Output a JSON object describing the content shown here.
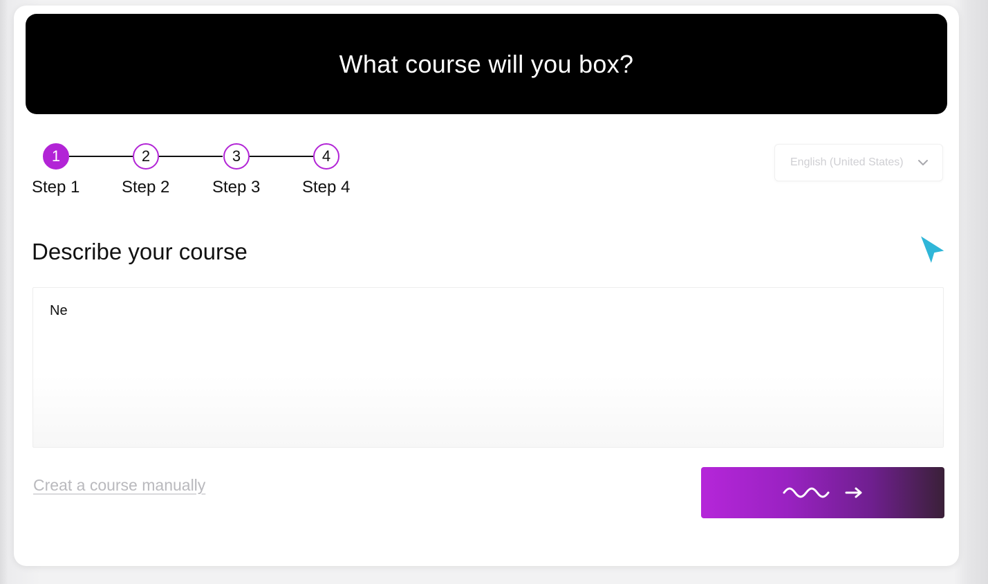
{
  "header": {
    "title": "What course will you box?"
  },
  "stepper": {
    "steps": [
      {
        "number": "1",
        "label": "Step 1",
        "active": true
      },
      {
        "number": "2",
        "label": "Step 2",
        "active": false
      },
      {
        "number": "3",
        "label": "Step 3",
        "active": false
      },
      {
        "number": "4",
        "label": "Step 4",
        "active": false
      }
    ]
  },
  "language_select": {
    "value": "English (United States)",
    "icon": "chevron-down-icon"
  },
  "course": {
    "section_title": "Describe your course",
    "description_value": "Ne"
  },
  "footer": {
    "manual_link": "Creat a course manually",
    "submit_icons": [
      "wave-icon",
      "arrow-right-icon"
    ]
  },
  "colors": {
    "accent": "#b224d6",
    "hero_bg": "#000000",
    "cursor": "#2fb6d8"
  }
}
